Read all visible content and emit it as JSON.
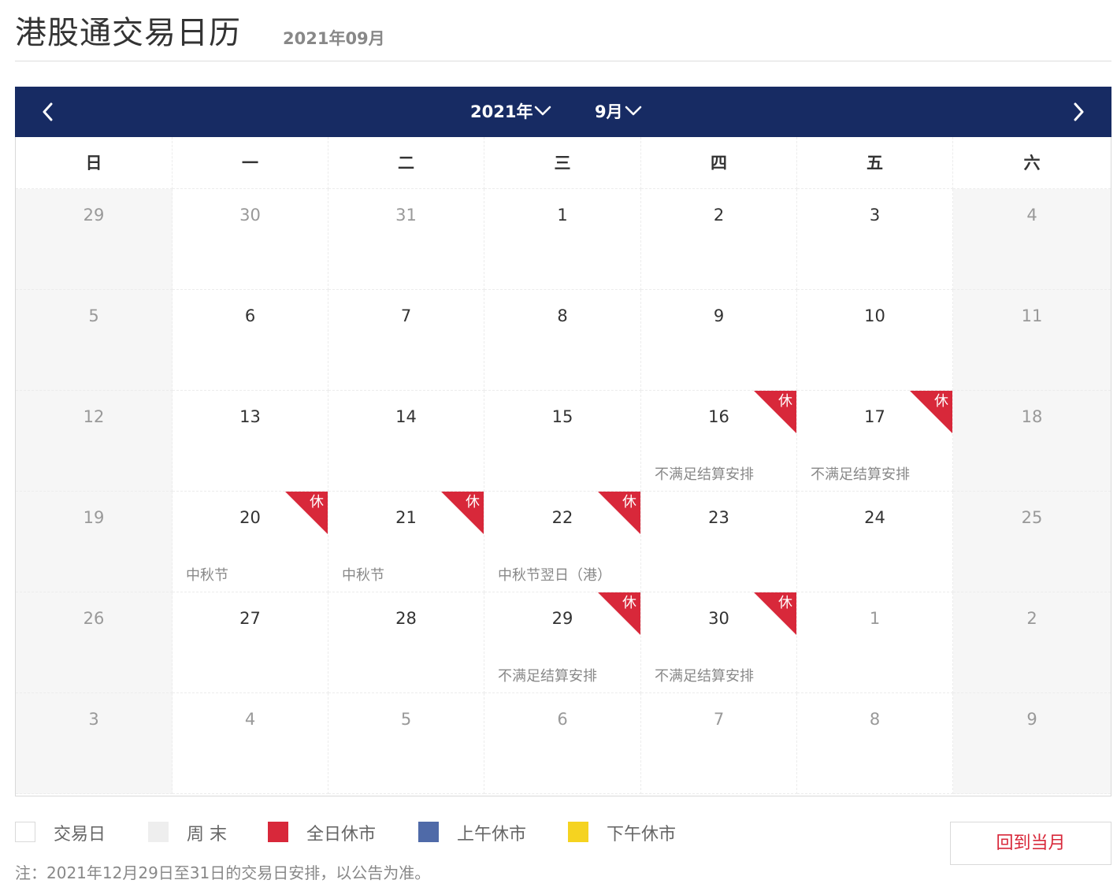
{
  "page": {
    "title": "港股通交易日历",
    "subtitle": "2021年09月"
  },
  "nav": {
    "year_label": "2021年",
    "month_label": "9月"
  },
  "weekdays": [
    "日",
    "一",
    "二",
    "三",
    "四",
    "五",
    "六"
  ],
  "weeks": [
    [
      {
        "day": "29",
        "muted": true
      },
      {
        "day": "30",
        "muted": true
      },
      {
        "day": "31",
        "muted": true
      },
      {
        "day": "1"
      },
      {
        "day": "2"
      },
      {
        "day": "3"
      },
      {
        "day": "4"
      }
    ],
    [
      {
        "day": "5"
      },
      {
        "day": "6"
      },
      {
        "day": "7"
      },
      {
        "day": "8"
      },
      {
        "day": "9"
      },
      {
        "day": "10"
      },
      {
        "day": "11"
      }
    ],
    [
      {
        "day": "12"
      },
      {
        "day": "13"
      },
      {
        "day": "14"
      },
      {
        "day": "15"
      },
      {
        "day": "16",
        "closed": true,
        "badge": "休",
        "note": "不满足结算安排"
      },
      {
        "day": "17",
        "closed": true,
        "badge": "休",
        "note": "不满足结算安排"
      },
      {
        "day": "18"
      }
    ],
    [
      {
        "day": "19"
      },
      {
        "day": "20",
        "closed": true,
        "badge": "休",
        "note": "中秋节"
      },
      {
        "day": "21",
        "closed": true,
        "badge": "休",
        "note": "中秋节"
      },
      {
        "day": "22",
        "closed": true,
        "badge": "休",
        "note": "中秋节翌日（港）"
      },
      {
        "day": "23"
      },
      {
        "day": "24"
      },
      {
        "day": "25"
      }
    ],
    [
      {
        "day": "26"
      },
      {
        "day": "27"
      },
      {
        "day": "28"
      },
      {
        "day": "29",
        "closed": true,
        "badge": "休",
        "note": "不满足结算安排"
      },
      {
        "day": "30",
        "closed": true,
        "badge": "休",
        "note": "不满足结算安排"
      },
      {
        "day": "1",
        "muted": true
      },
      {
        "day": "2",
        "muted": true
      }
    ],
    [
      {
        "day": "3",
        "muted": true
      },
      {
        "day": "4",
        "muted": true
      },
      {
        "day": "5",
        "muted": true
      },
      {
        "day": "6",
        "muted": true
      },
      {
        "day": "7",
        "muted": true
      },
      {
        "day": "8",
        "muted": true
      },
      {
        "day": "9",
        "muted": true
      }
    ]
  ],
  "legend": [
    {
      "label": "交易日",
      "color": "#ffffff"
    },
    {
      "label": "周 末",
      "color": "#eeeeee"
    },
    {
      "label": "全日休市",
      "color": "#d8283a"
    },
    {
      "label": "上午休市",
      "color": "#4f6aa8"
    },
    {
      "label": "下午休市",
      "color": "#f5d320"
    }
  ],
  "back_button": "回到当月",
  "footnote": "注：2021年12月29日至31日的交易日安排，以公告为准。",
  "colors": {
    "navbar": "#172b63",
    "closed_badge": "#d8283a",
    "weekend_bg": "#f6f6f6"
  }
}
